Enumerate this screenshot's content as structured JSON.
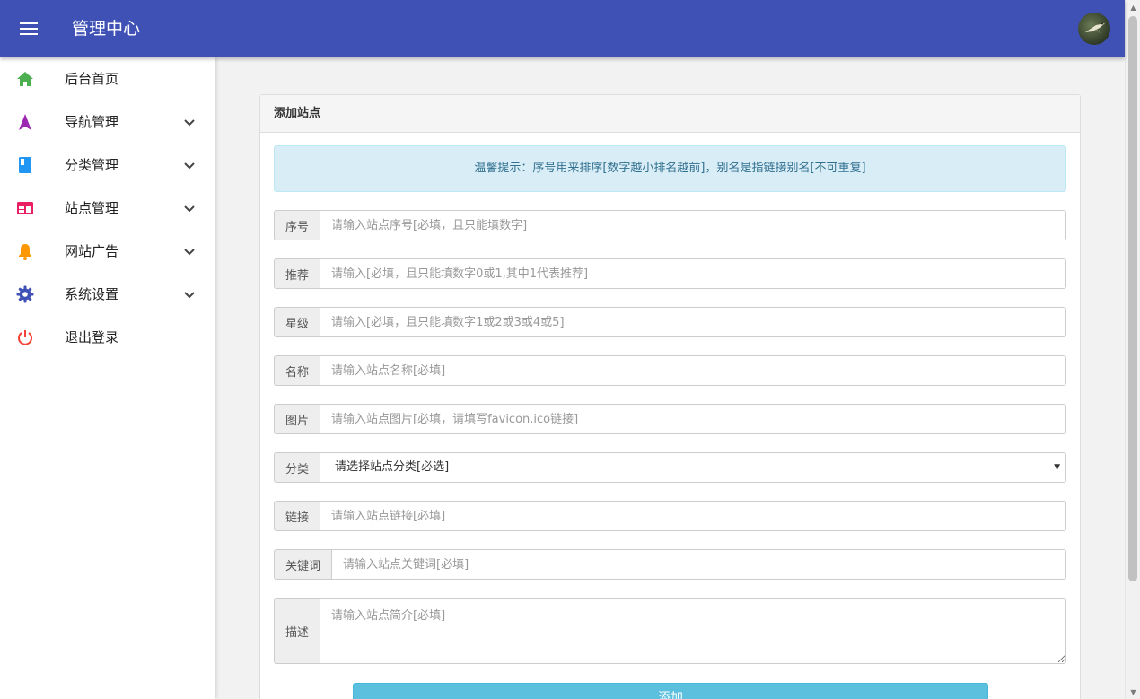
{
  "header": {
    "title": "管理中心",
    "menu_icon": "hamburger-icon",
    "avatar_icon": "user-avatar"
  },
  "sidebar": {
    "items": [
      {
        "label": "后台首页",
        "icon": "home-icon",
        "color": "#4caf50",
        "expandable": false
      },
      {
        "label": "导航管理",
        "icon": "navigation-icon",
        "color": "#9c27b0",
        "expandable": true
      },
      {
        "label": "分类管理",
        "icon": "book-icon",
        "color": "#2196f3",
        "expandable": true
      },
      {
        "label": "站点管理",
        "icon": "web-icon",
        "color": "#e91e63",
        "expandable": true
      },
      {
        "label": "网站广告",
        "icon": "bell-icon",
        "color": "#ff9800",
        "expandable": true
      },
      {
        "label": "系统设置",
        "icon": "gear-icon",
        "color": "#3f51b5",
        "expandable": true
      },
      {
        "label": "退出登录",
        "icon": "power-icon",
        "color": "#f44336",
        "expandable": false
      }
    ]
  },
  "panel": {
    "title": "添加站点",
    "notice": "温馨提示：序号用来排序[数字越小排名越前]，别名是指链接别名[不可重复]",
    "fields": {
      "sort": {
        "label": "序号",
        "placeholder": "请输入站点序号[必填，且只能填数字]"
      },
      "recommend": {
        "label": "推荐",
        "placeholder": "请输入[必填，且只能填数字0或1,其中1代表推荐]"
      },
      "stars": {
        "label": "星级",
        "placeholder": "请输入[必填，且只能填数字1或2或3或4或5]"
      },
      "name": {
        "label": "名称",
        "placeholder": "请输入站点名称[必填]"
      },
      "image": {
        "label": "图片",
        "placeholder": "请输入站点图片[必填，请填写favicon.ico链接]"
      },
      "category": {
        "label": "分类",
        "selected": "请选择站点分类[必选]"
      },
      "link": {
        "label": "链接",
        "placeholder": "请输入站点链接[必填]"
      },
      "keywords": {
        "label": "关键词",
        "placeholder": "请输入站点关键词[必填]"
      },
      "description": {
        "label": "描述",
        "placeholder": "请输入站点简介[必填]"
      }
    },
    "submit_label": "添加"
  },
  "colors": {
    "header_bg": "#3f51b5",
    "alert_bg": "#d9edf7",
    "alert_text": "#31708f",
    "submit_bg": "#5bc0de"
  }
}
